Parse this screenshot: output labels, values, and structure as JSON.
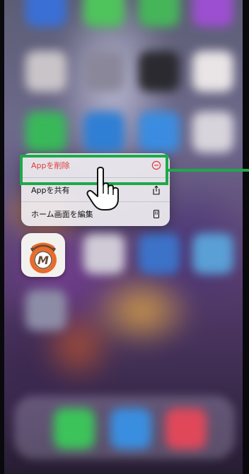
{
  "context_menu": {
    "items": [
      {
        "label": "Appを削除",
        "icon": "minus-circle-icon",
        "color": "#e2393a",
        "highlighted": true
      },
      {
        "label": "Appを共有",
        "icon": "share-icon"
      },
      {
        "label": "ホーム画面を編集",
        "icon": "phone-screen-icon"
      }
    ]
  },
  "annotation": {
    "color": "#1fa84a",
    "target": "delete-app-item"
  },
  "app": {
    "icon": "moneyforward-style-app-icon",
    "logo_letter": "M"
  }
}
